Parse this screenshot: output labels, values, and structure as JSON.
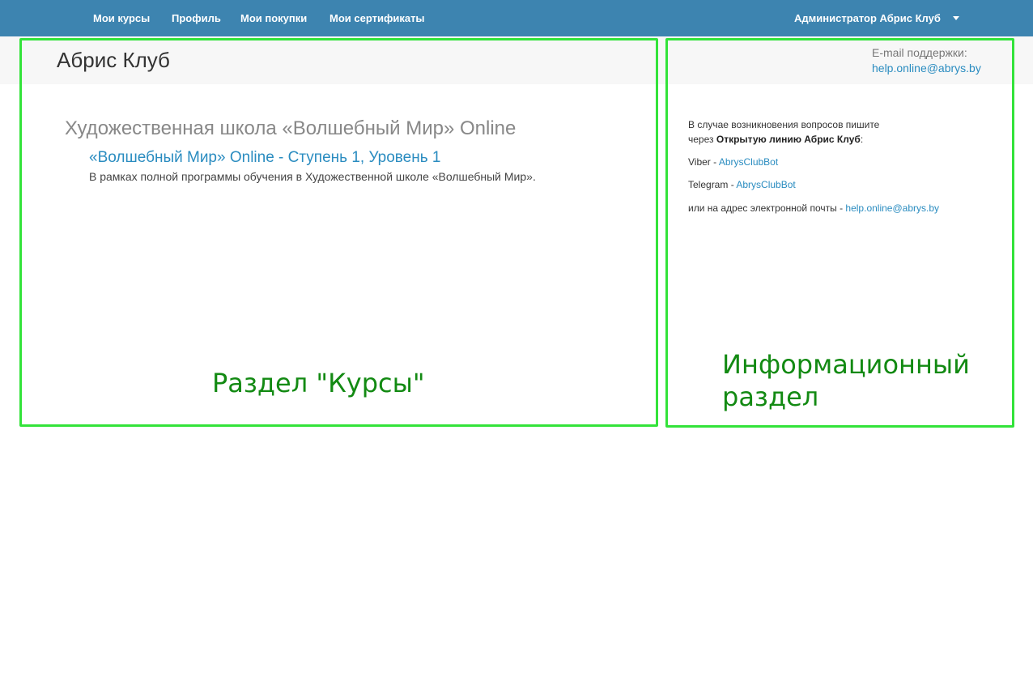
{
  "nav": {
    "items": [
      {
        "label": "Мои курсы"
      },
      {
        "label": "Профиль"
      },
      {
        "label": "Мои покупки"
      },
      {
        "label": "Мои сертификаты"
      }
    ],
    "user": "Администратор Абрис Клуб"
  },
  "header": {
    "title": "Абрис Клуб",
    "support_label": "E-mail поддержки:",
    "support_email": "help.online@abrys.by"
  },
  "courses": {
    "school_title": "Художественная школа «Волшебный Мир» Online",
    "course_title": "«Волшебный Мир» Online - Ступень 1, Уровень 1",
    "course_desc": "В рамках полной программы обучения в Художественной школе «Волшебный Мир»."
  },
  "info": {
    "line1": "В случае возникновения вопросов пишите",
    "line2_prefix": "через ",
    "line2_bold": "Открытую линию Абрис Клуб",
    "line2_suffix": ":",
    "viber_prefix": "Viber - ",
    "viber_link": "AbrysClubBot",
    "telegram_prefix": "Telegram - ",
    "telegram_link": "AbrysClubBot",
    "email_prefix": "или на адрес электронной почты - ",
    "email_link": "help.online@abrys.by"
  },
  "annotations": {
    "courses_label": "Раздел \"Курсы\"",
    "info_label_line1": "Информационный",
    "info_label_line2": "раздел",
    "color": "#33e33a",
    "text_color": "#138a13"
  },
  "colors": {
    "navbar": "#3d84b0",
    "link": "#2a8cc0",
    "header_band": "#f7f7f7"
  }
}
